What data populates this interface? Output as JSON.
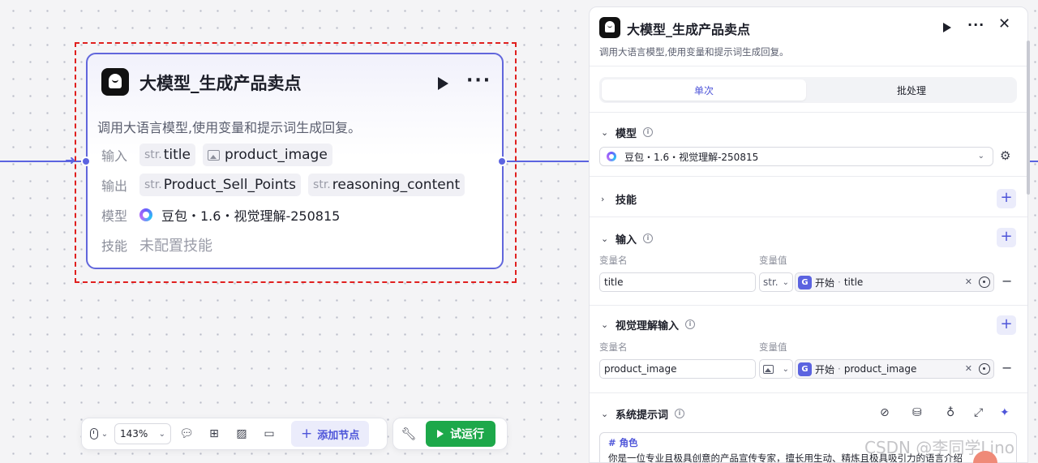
{
  "node": {
    "title": "大模型_生成产品卖点",
    "description": "调用大语言模型,使用变量和提示词生成回复。",
    "input_label": "输入",
    "inputs": [
      {
        "type": "str.",
        "name": "title"
      },
      {
        "type": "image",
        "name": "product_image"
      }
    ],
    "output_label": "输出",
    "outputs": [
      {
        "type": "str.",
        "name": "Product_Sell_Points"
      },
      {
        "type": "str.",
        "name": "reasoning_content"
      }
    ],
    "model_label": "模型",
    "model_name": "豆包・1.6・视觉理解-250815",
    "skill_label": "技能",
    "skill_value": "未配置技能"
  },
  "toolbar": {
    "zoom": "143%",
    "add_node_label": "添加节点",
    "test_run_label": "试运行"
  },
  "panel": {
    "title": "大模型_生成产品卖点",
    "description": "调用大语言模型,使用变量和提示词生成回复。",
    "tabs": [
      {
        "label": "单次",
        "active": true
      },
      {
        "label": "批处理",
        "active": false
      }
    ],
    "model_section": {
      "label": "模型",
      "selected": "豆包・1.6・视觉理解-250815"
    },
    "skill_section": {
      "label": "技能"
    },
    "input_section": {
      "label": "输入",
      "col_name": "变量名",
      "col_value": "变量值",
      "rows": [
        {
          "name": "title",
          "type": "str.",
          "ref_source": "开始",
          "ref_dot": "·",
          "ref_var": "title"
        }
      ]
    },
    "vision_section": {
      "label": "视觉理解输入",
      "col_name": "变量名",
      "col_value": "变量值",
      "rows": [
        {
          "name": "product_image",
          "type": "image",
          "ref_source": "开始",
          "ref_dot": "·",
          "ref_var": "product_image"
        }
      ]
    },
    "system_prompt_section": {
      "label": "系统提示词",
      "line1": "# 角色",
      "line2": "你是一位专业且极具创意的产品宣传专家，擅长用生动、精炼且极具吸引力的语言介绍"
    }
  },
  "watermark": "CSDN @李同学Lino",
  "colors": {
    "accent": "#5b63e0",
    "run_green": "#1da84a",
    "selection_red": "#e0201f"
  }
}
